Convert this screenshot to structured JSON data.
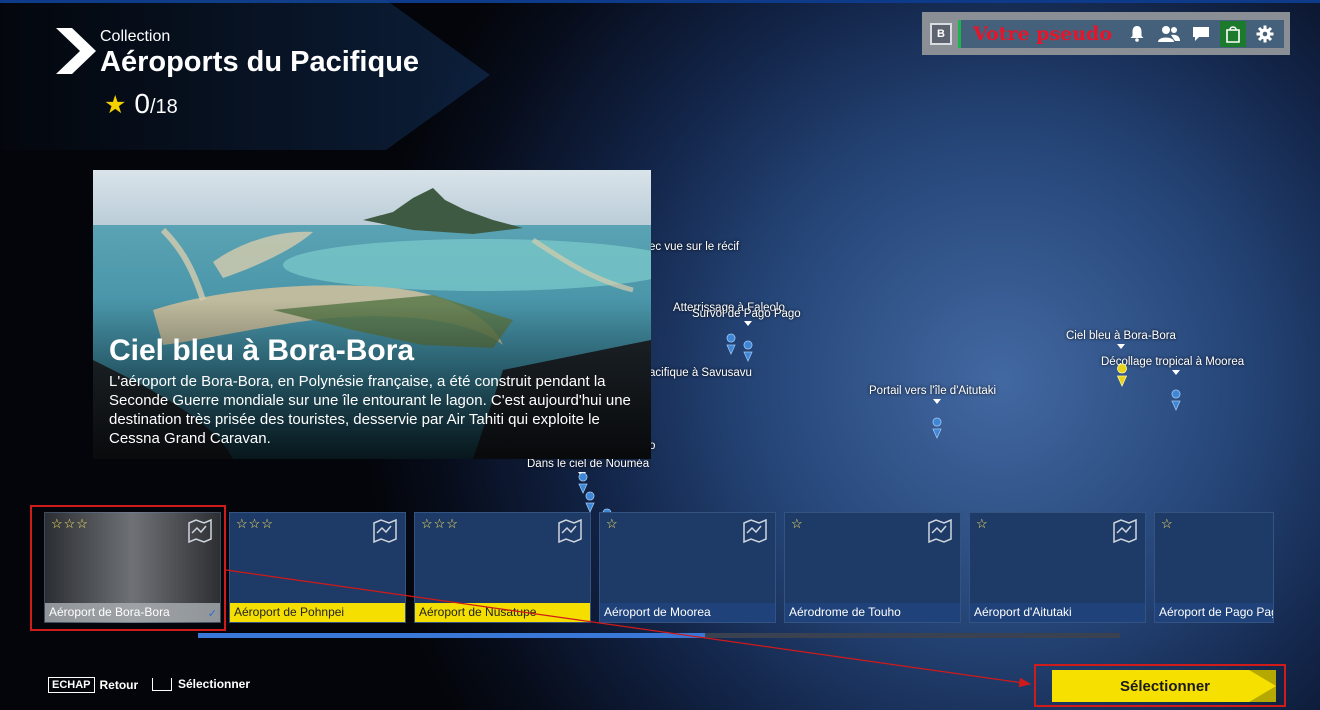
{
  "header": {
    "collection_label": "Collection",
    "title": "Aéroports du Pacifique",
    "score": "0",
    "score_total": "/18"
  },
  "topbar": {
    "badge": "B",
    "pseudo": "Votre pseudo",
    "icons": [
      "bell-icon",
      "friends-icon",
      "chat-icon",
      "store-icon",
      "gear-icon"
    ]
  },
  "preview": {
    "title": "Ciel bleu à Bora-Bora",
    "description": "L'aéroport de Bora-Bora, en Polynésie française, a été construit pendant la Seconde Guerre mondiale sur une île entourant le lagon. C'est aujourd'hui une destination très prisée des touristes, desservie par Air Tahiti qui exploite le Cessna Grand Caravan."
  },
  "map_labels": [
    "ec vue sur le récif",
    "Atterrissage à Faleolo",
    "Survol de Pago Pago",
    "Ciel bleu à Bora-Bora",
    "Décollage tropical à Moorea",
    "acifique à Savusavu",
    "Portail vers l'île d'Aitutaki",
    "Dans le ciel de Nouméa",
    "o"
  ],
  "tiles": [
    {
      "name": "Aéroport de Bora-Bora",
      "stars": "☆☆☆"
    },
    {
      "name": "Aéroport de Pohnpei",
      "stars": "☆☆☆"
    },
    {
      "name": "Aéroport de Nusatupe",
      "stars": "☆☆☆"
    },
    {
      "name": "Aéroport de Moorea",
      "stars": "☆"
    },
    {
      "name": "Aérodrome de Touho",
      "stars": "☆"
    },
    {
      "name": "Aéroport d'Aitutaki",
      "stars": "☆"
    },
    {
      "name": "Aéroport de Pago Pago",
      "stars": "☆"
    }
  ],
  "scroll_progress": 0.55,
  "footer": {
    "back_key": "ECHAP",
    "back_label": "Retour",
    "select_label": "Sélectionner"
  },
  "select_button": "Sélectionner",
  "colors": {
    "accent_yellow": "#f5e000",
    "annotation_red": "#d11a1a",
    "pseudo_red": "#e8142a",
    "tile_blue": "#1e3a66"
  }
}
